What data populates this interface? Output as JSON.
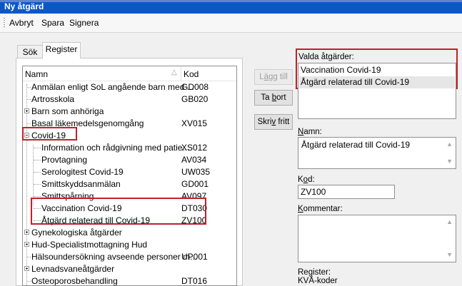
{
  "window": {
    "title": "Ny åtgärd"
  },
  "toolbar": {
    "cancel": "Avbryt",
    "save": "Spara",
    "sign": "Signera"
  },
  "tabs": [
    {
      "label": "Sök"
    },
    {
      "label": "Register"
    }
  ],
  "tree": {
    "col_name": "Namn",
    "col_code": "Kod",
    "rows": [
      {
        "label": "Anmälan enligt SoL angående barn med ...",
        "code": "GD008"
      },
      {
        "label": "Artrosskola",
        "code": "GB020"
      },
      {
        "label": "Barn som anhöriga",
        "code": ""
      },
      {
        "label": "Basal läkemedelsgenomgång",
        "code": "XV015"
      },
      {
        "label": "Covid-19",
        "code": ""
      },
      {
        "label": "Information och rådgivning med patie...",
        "code": "XS012"
      },
      {
        "label": "Provtagning",
        "code": "AV034"
      },
      {
        "label": "Serologitest Covid-19",
        "code": "UW035"
      },
      {
        "label": "Smittskyddsanmälan",
        "code": "GD001"
      },
      {
        "label": "Smittspårning",
        "code": "AV097"
      },
      {
        "label": "Vaccination Covid-19",
        "code": "DT030"
      },
      {
        "label": "Åtgärd relaterad till Covid-19",
        "code": "ZV100"
      },
      {
        "label": "Gynekologiska åtgärder",
        "code": ""
      },
      {
        "label": "Hud-Specialistmottagning Hud",
        "code": ""
      },
      {
        "label": "Hälsoundersökning avseende personer m...",
        "code": "UP001"
      },
      {
        "label": "Levnadsvaneåtgärder",
        "code": ""
      },
      {
        "label": "Osteoporosbehandling",
        "code": "DT016"
      }
    ]
  },
  "buttons": {
    "add_pre": "L",
    "add_u": "ä",
    "add_post": "gg till",
    "remove_pre": "Ta ",
    "remove_u": "b",
    "remove_post": "ort",
    "write_pre": "Skri",
    "write_u": "v",
    "write_post": " fritt"
  },
  "selected": {
    "label": "Valda åtgärder:",
    "items": [
      "Vaccination Covid-19",
      "Åtgärd relaterad till Covid-19"
    ]
  },
  "name_field": {
    "label_u": "N",
    "label_rest": "amn:",
    "value": "Åtgärd relaterad till Covid-19"
  },
  "code_field": {
    "label_pre": "K",
    "label_u": "o",
    "label_post": "d:",
    "value": "ZV100"
  },
  "comment_field": {
    "label_pre": "",
    "label_u": "K",
    "label_post": "ommentar:",
    "value": ""
  },
  "register": {
    "label": "Register:",
    "value": "KVÅ-koder"
  }
}
